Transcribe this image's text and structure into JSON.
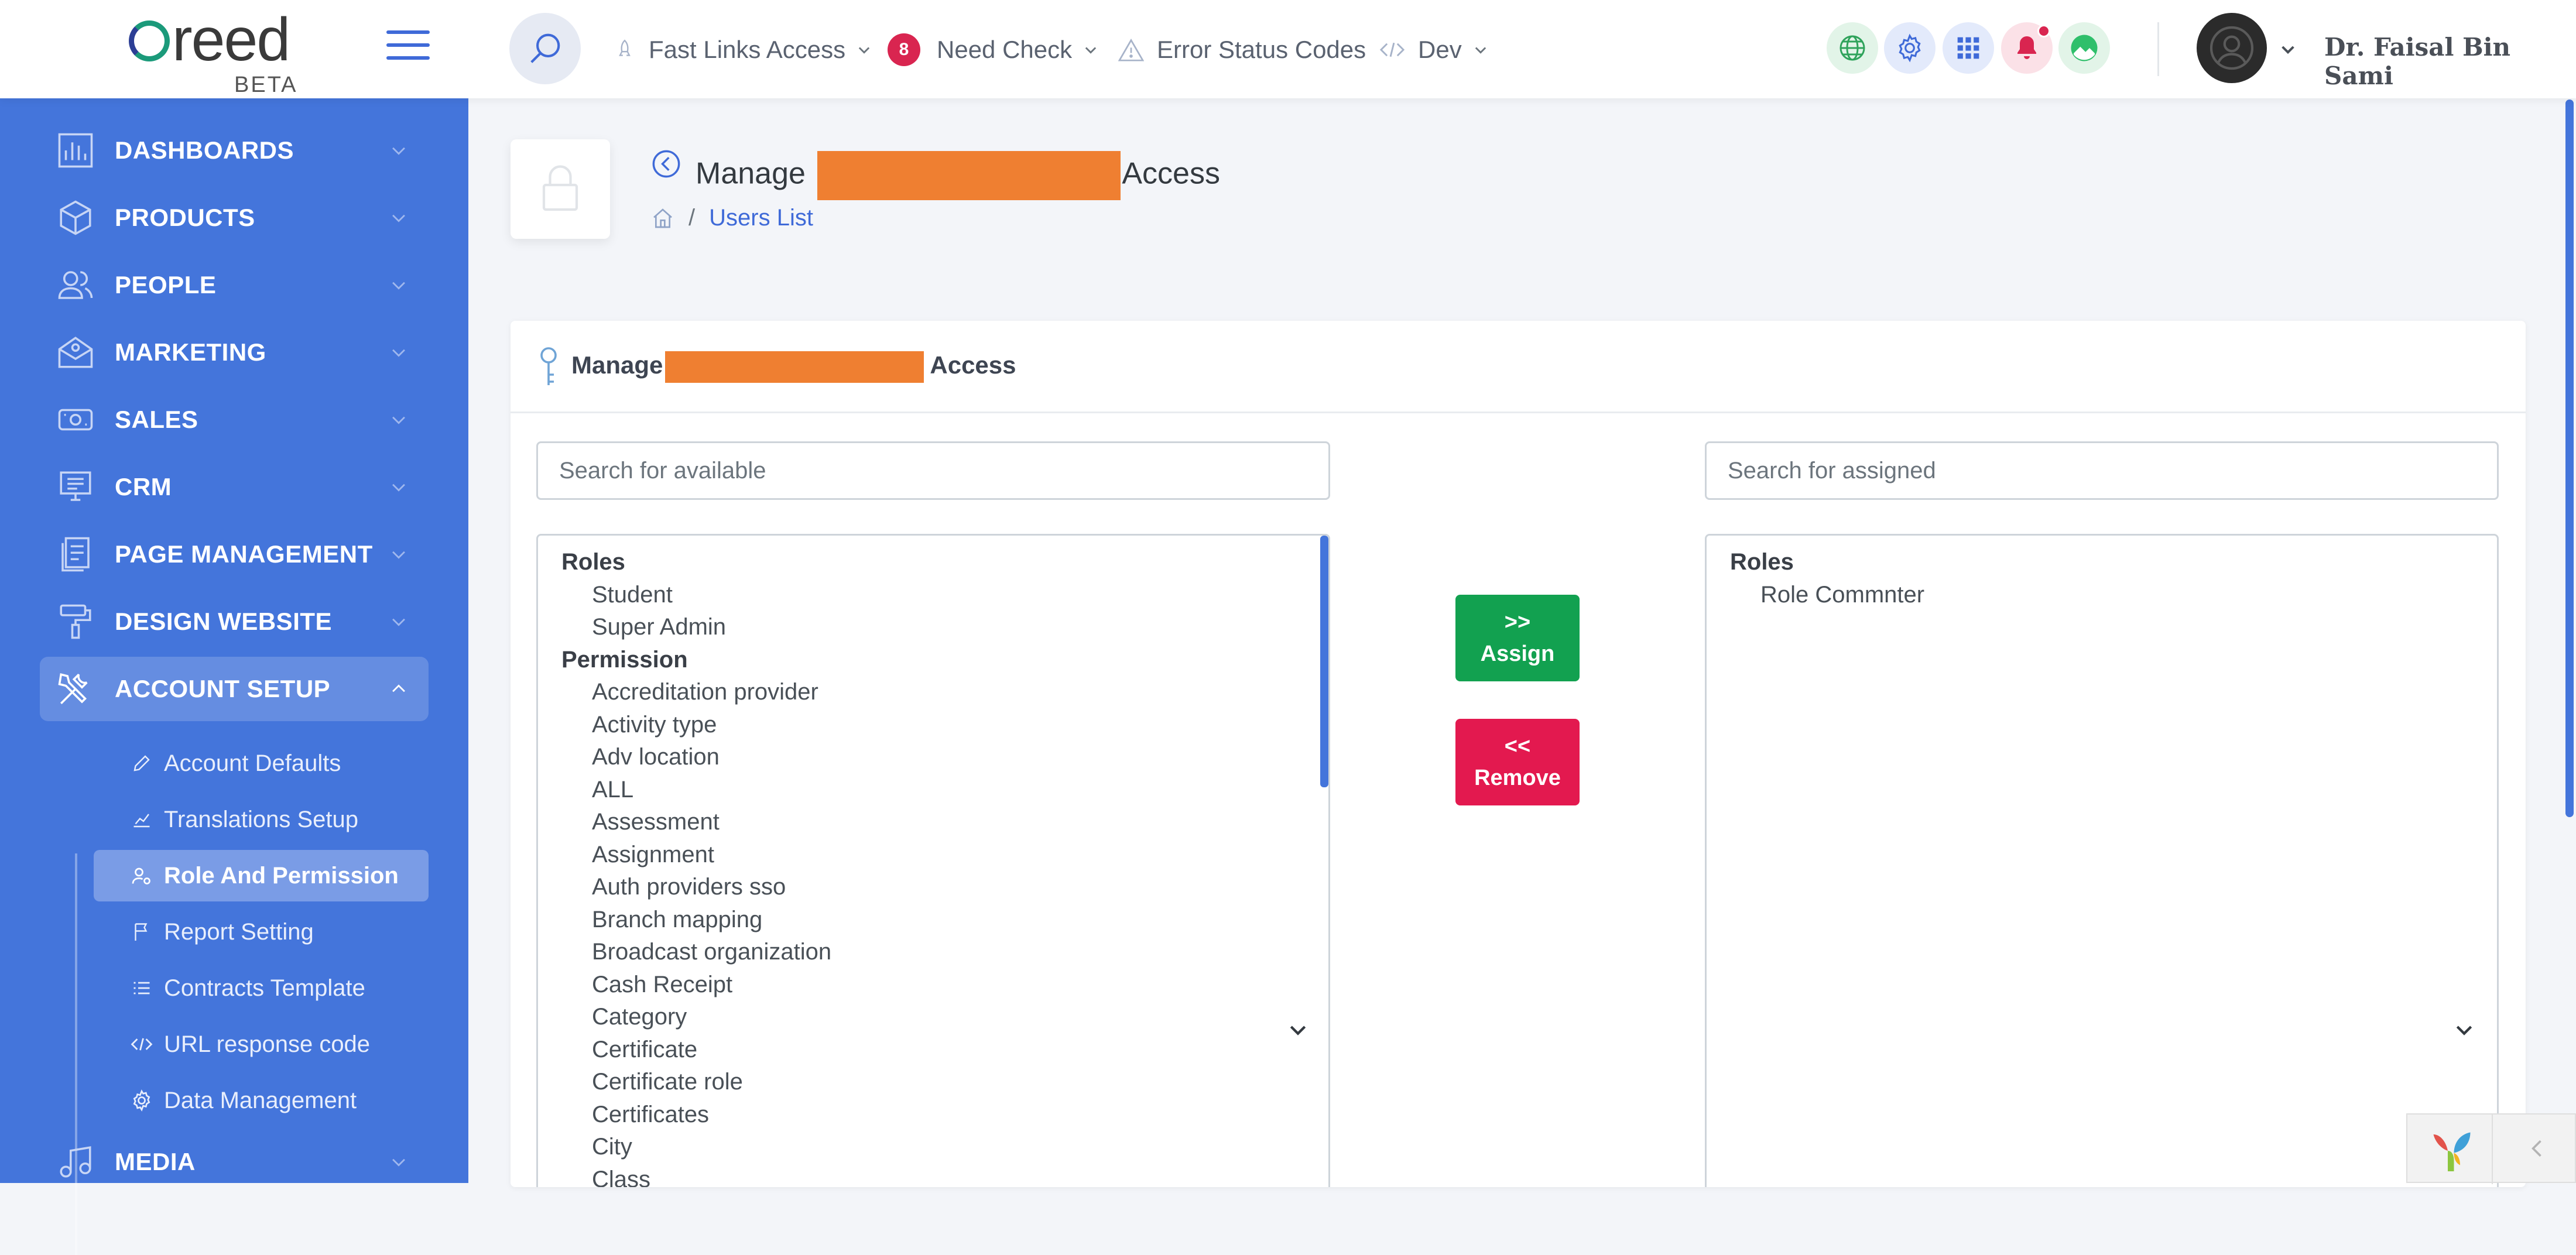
{
  "brand": {
    "logo_text": "reed",
    "beta": "BETA"
  },
  "header": {
    "nav": [
      {
        "label": "Fast Links Access",
        "icon": "rocket-icon"
      },
      {
        "label": "Need Check",
        "badge": "8",
        "icon": "badge"
      },
      {
        "label": "Error Status Codes",
        "icon": "warning-icon"
      },
      {
        "label": "Dev",
        "icon": "code-icon"
      }
    ],
    "icons": [
      "globe-icon",
      "gear-icon",
      "grid-icon",
      "bell-icon",
      "landscape-icon"
    ],
    "user_name": "Dr. Faisal Bin Sami"
  },
  "sidebar": {
    "items": [
      {
        "label": "DASHBOARDS"
      },
      {
        "label": "PRODUCTS"
      },
      {
        "label": "PEOPLE"
      },
      {
        "label": "MARKETING"
      },
      {
        "label": "SALES"
      },
      {
        "label": "CRM"
      },
      {
        "label": "PAGE MANAGEMENT"
      },
      {
        "label": "DESIGN WEBSITE"
      },
      {
        "label": "ACCOUNT SETUP"
      },
      {
        "label": "MEDIA"
      }
    ],
    "sub_items": [
      {
        "label": "Account Defaults"
      },
      {
        "label": "Translations Setup"
      },
      {
        "label": "Role And Permission"
      },
      {
        "label": "Report Setting"
      },
      {
        "label": "Contracts Template"
      },
      {
        "label": "URL response code"
      },
      {
        "label": "Data Management"
      }
    ]
  },
  "page": {
    "title_prefix": "Manage",
    "title_suffix": "Access",
    "breadcrumb": "Users List"
  },
  "card": {
    "title_prefix": "Manage",
    "title_suffix": "Access",
    "search_available_placeholder": "Search for available",
    "search_assigned_placeholder": "Search for assigned",
    "available": {
      "groups": [
        {
          "label": "Roles",
          "options": [
            "Student",
            "Super Admin"
          ]
        },
        {
          "label": "Permission",
          "options": [
            "Accreditation provider",
            "Activity type",
            "Adv location",
            "ALL",
            "Assessment",
            "Assignment",
            "Auth providers sso",
            "Branch mapping",
            "Broadcast organization",
            "Cash Receipt",
            "Category",
            "Certificate",
            "Certificate role",
            "Certificates",
            "City",
            "Class"
          ]
        }
      ]
    },
    "assigned": {
      "groups": [
        {
          "label": "Roles",
          "options": [
            "Role Commnter"
          ]
        }
      ]
    },
    "assign_arrows": ">>",
    "assign_label": "Assign",
    "remove_arrows": "<<",
    "remove_label": "Remove"
  },
  "colors": {
    "primary": "#4475db",
    "success": "#12a150",
    "danger": "#e3194f",
    "redaction": "#ef7f31"
  }
}
